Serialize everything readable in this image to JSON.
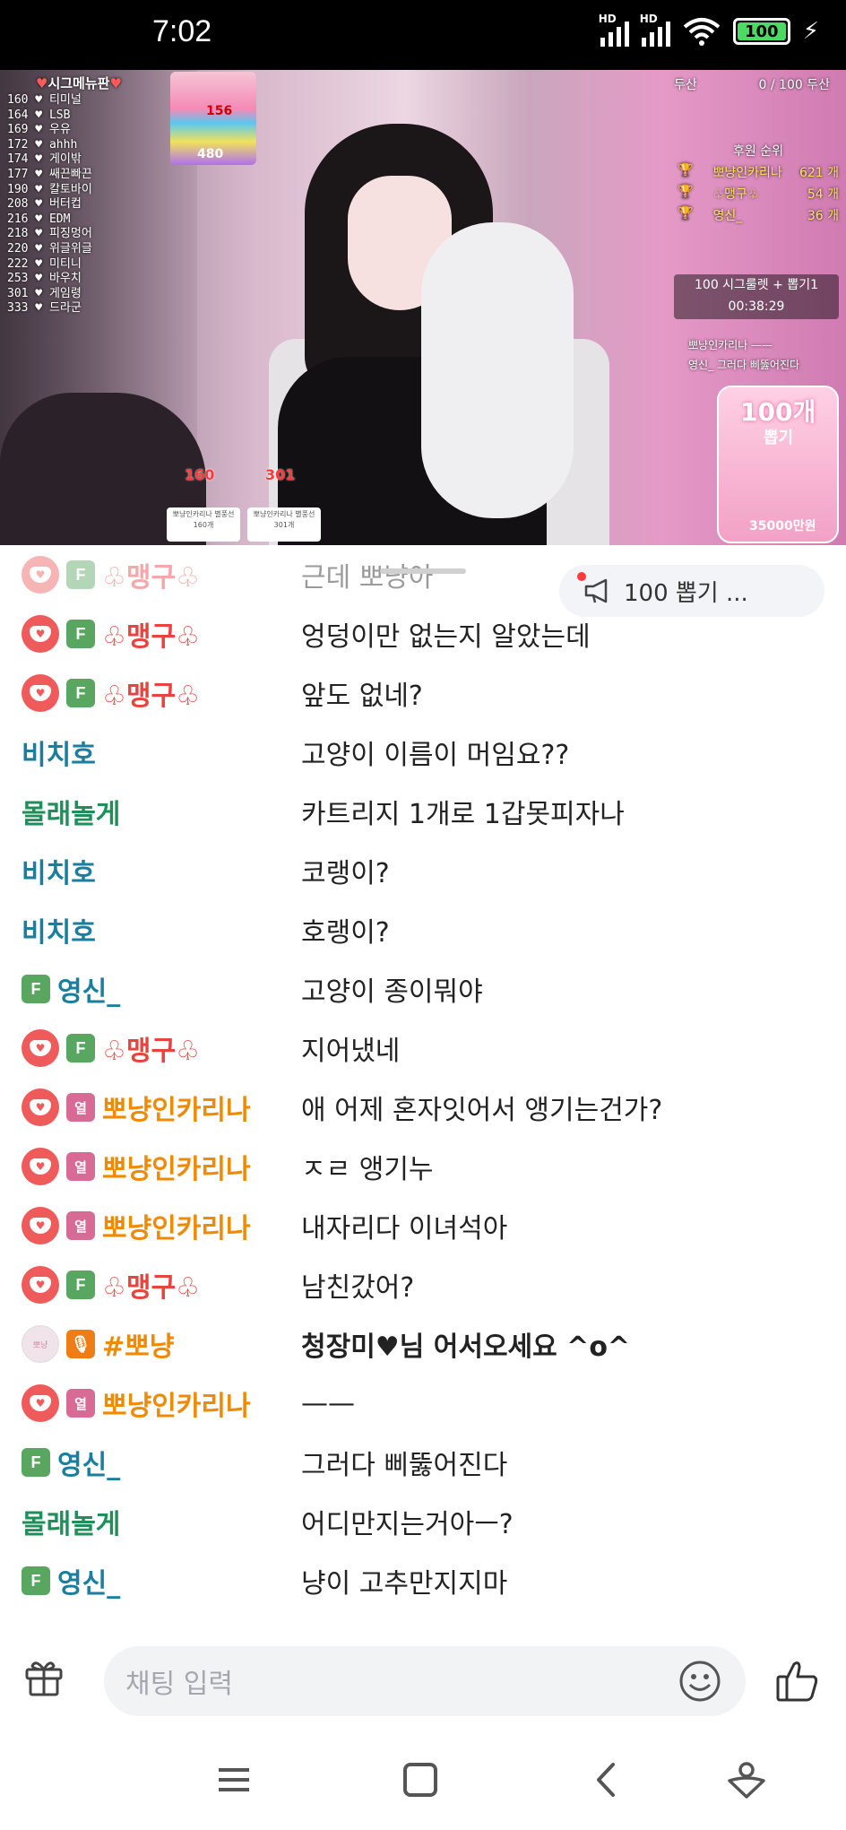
{
  "status_bar": {
    "time": "7:02",
    "signal1_label": "HD",
    "signal2_label": "HD",
    "battery": "100"
  },
  "video": {
    "overlay_top_left_title": "시그메뉴판",
    "signature_menu": [
      "160 ♥ 티미널",
      "164 ♥ LSB",
      "169 ♥ 우유",
      "172 ♥ ahhh",
      "174 ♥ 게이밖",
      "177 ♥ 쌔끈빠끈",
      "190 ♥ 칼토바이",
      "208 ♥ 버터컵",
      "216 ♥ EDM",
      "218 ♥ 피징멍어",
      "220 ♥ 위글위글",
      "222 ♥ 미티니",
      "253 ♥ 바우치",
      "301 ♥ 게임령",
      "333 ♥ 드라군"
    ],
    "card_top_num": "156",
    "card_bottom_num": "480",
    "top_right_left": "두산",
    "top_right_right": "0 / 100 두산",
    "ranking_title": "후원 순위",
    "ranking": [
      {
        "name": "뽀냥인카리나",
        "count": "621 개"
      },
      {
        "name": "♧맹구♧",
        "count": "54 개"
      },
      {
        "name": "영신_",
        "count": "36 개"
      }
    ],
    "roulette_title": "100 시그룰렛 + 뽑기1",
    "roulette_timer": "00:38:29",
    "mini_log": [
      "뽀냥인카리나 ——",
      "영신_ 그러다 삐뚫어진다"
    ],
    "gift_board_title": "100개",
    "gift_board_sub": "뽑기",
    "gift_board_bottom": "35000만원",
    "balloon1_num": "160",
    "balloon1_caption": "뽀냥인카리나 별풍선 160개",
    "balloon2_num": "301",
    "balloon2_caption": "뽀냥인카리나 별풍선 301개"
  },
  "notice": {
    "label": "100 뽑기 ..."
  },
  "chat": {
    "messages": [
      {
        "nick": "♧맹구♧",
        "text": "근데 뽀냥아"
      },
      {
        "nick": "♧맹구♧",
        "text": "엉덩이만 없는지 알았는데"
      },
      {
        "nick": "♧맹구♧",
        "text": "앞도 없네?"
      },
      {
        "nick": "비치호",
        "text": "고양이 이름이 머임요??"
      },
      {
        "nick": "몰래놀게",
        "text": "카트리지 1개로 1갑못피자나"
      },
      {
        "nick": "비치호",
        "text": "코랭이?"
      },
      {
        "nick": "비치호",
        "text": "호랭이?"
      },
      {
        "nick": "영신_",
        "text": "고양이 종이뭐야"
      },
      {
        "nick": "♧맹구♧",
        "text": "지어냈네"
      },
      {
        "nick": "뽀냥인카리나",
        "text": "애 어제 혼자잇어서 앵기는건가?"
      },
      {
        "nick": "뽀냥인카리나",
        "text": "ㅈㄹ 앵기누"
      },
      {
        "nick": "뽀냥인카리나",
        "text": "내자리다 이녀석아"
      },
      {
        "nick": "♧맹구♧",
        "text": "남친갔어?"
      },
      {
        "nick": "#뽀냥",
        "text": "청장미♥님 어서오세요 ^o^"
      },
      {
        "nick": "뽀냥인카리나",
        "text": "——"
      },
      {
        "nick": "영신_",
        "text": "그러다 삐뚫어진다"
      },
      {
        "nick": "몰래놀게",
        "text": "어디만지는거아ㅡ?"
      },
      {
        "nick": "영신_",
        "text": "냥이 고추만지지마"
      }
    ],
    "tier_f": "F",
    "tier_y": "열",
    "avatar_text": "뽀냥"
  },
  "input": {
    "placeholder": "채팅 입력"
  },
  "colors": {
    "nick_red": "#e8433f",
    "nick_teal": "#1a7e9e",
    "nick_green": "#1f8f5a",
    "nick_orange": "#ef8a05",
    "tier_f": "#58a660",
    "tier_y": "#d86a96"
  }
}
